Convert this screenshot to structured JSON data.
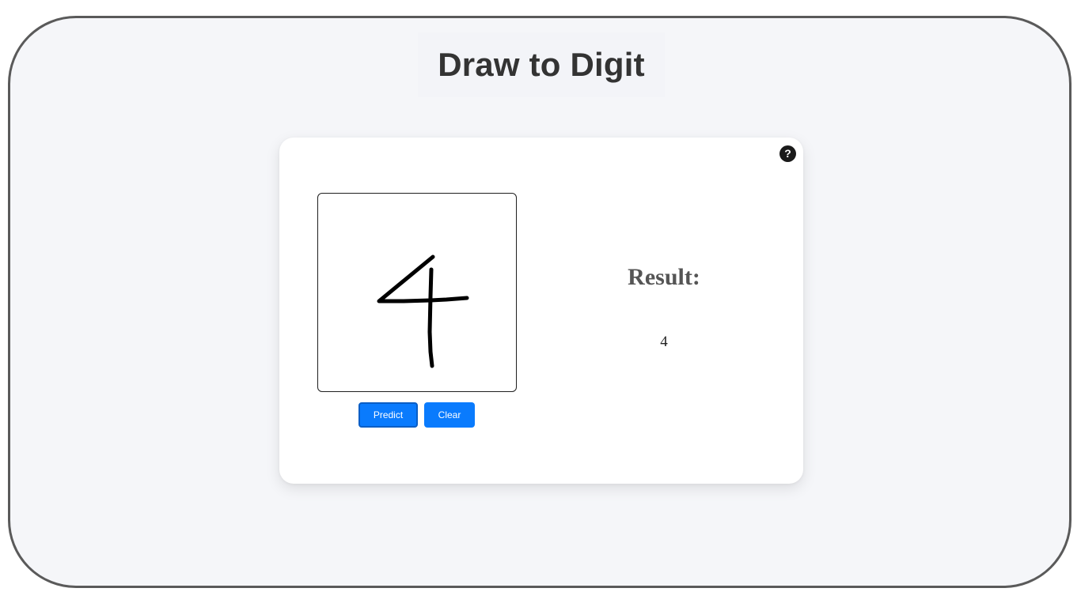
{
  "page": {
    "title": "Draw to Digit"
  },
  "card": {
    "help_icon": {
      "name": "help-icon",
      "glyph": "?"
    },
    "canvas": {
      "drawn_digit": "4",
      "stroke_color": "#000000"
    },
    "buttons": {
      "predict_label": "Predict",
      "clear_label": "Clear"
    },
    "result": {
      "heading": "Result:",
      "value": "4"
    }
  },
  "colors": {
    "accent": "#0a7bfd",
    "background": "#f5f6f9",
    "card": "#ffffff",
    "frame_border": "#5a5a5a"
  }
}
